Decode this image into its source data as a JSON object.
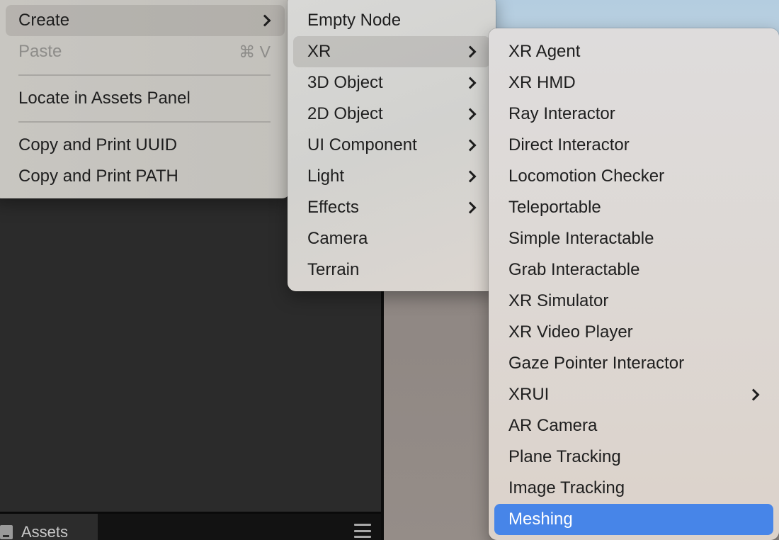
{
  "background": {
    "assets_tab_label": "Assets",
    "assets_tab_icon": "folder-icon",
    "panel_menu_icon": "hamburger-menu-icon"
  },
  "context_menu": {
    "items": [
      {
        "label": "Create",
        "submenu": true,
        "state": "highlighted"
      },
      {
        "label": "Paste",
        "shortcut": "⌘ V",
        "state": "disabled"
      },
      {
        "label": "Locate in Assets Panel"
      },
      {
        "label": "Copy and Print UUID"
      },
      {
        "label": "Copy and Print PATH"
      }
    ]
  },
  "create_submenu": {
    "items": [
      {
        "label": "Empty Node"
      },
      {
        "label": "XR",
        "submenu": true,
        "state": "highlighted"
      },
      {
        "label": "3D Object",
        "submenu": true
      },
      {
        "label": "2D Object",
        "submenu": true
      },
      {
        "label": "UI Component",
        "submenu": true
      },
      {
        "label": "Light",
        "submenu": true
      },
      {
        "label": "Effects",
        "submenu": true
      },
      {
        "label": "Camera"
      },
      {
        "label": "Terrain"
      }
    ]
  },
  "xr_submenu": {
    "items": [
      {
        "label": "XR Agent"
      },
      {
        "label": "XR HMD"
      },
      {
        "label": "Ray Interactor"
      },
      {
        "label": "Direct Interactor"
      },
      {
        "label": "Locomotion Checker"
      },
      {
        "label": "Teleportable"
      },
      {
        "label": "Simple Interactable"
      },
      {
        "label": "Grab Interactable"
      },
      {
        "label": "XR Simulator"
      },
      {
        "label": "XR Video Player"
      },
      {
        "label": "Gaze Pointer Interactor"
      },
      {
        "label": "XRUI",
        "submenu": true
      },
      {
        "label": "AR Camera"
      },
      {
        "label": "Plane Tracking"
      },
      {
        "label": "Image Tracking"
      },
      {
        "label": "Meshing",
        "state": "selected"
      }
    ]
  },
  "colors": {
    "selection": "#4785e8",
    "menu_text": "#1e1e1e",
    "disabled_text": "#8d8c89"
  }
}
